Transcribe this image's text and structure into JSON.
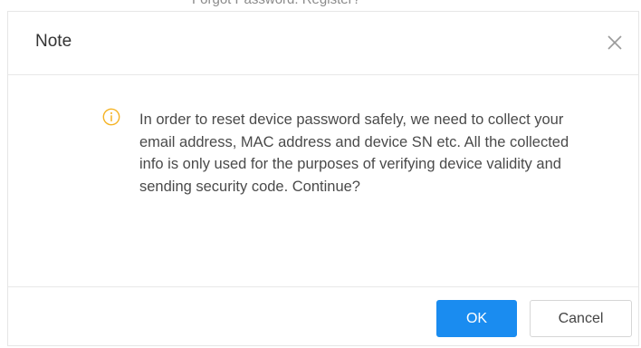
{
  "background_text": "Forgot Password. Register?",
  "dialog": {
    "title": "Note",
    "close_icon": "close-icon",
    "info_icon": "info-icon",
    "message": "In order to reset device password safely, we need to collect your email address, MAC address and device SN etc. All the collected info is only used for the purposes of verifying device validity and sending security code. Continue?",
    "ok_label": "OK",
    "cancel_label": "Cancel"
  },
  "colors": {
    "primary": "#1a8cf0",
    "info_icon": "#f5b323",
    "border": "#e8e8e8"
  }
}
